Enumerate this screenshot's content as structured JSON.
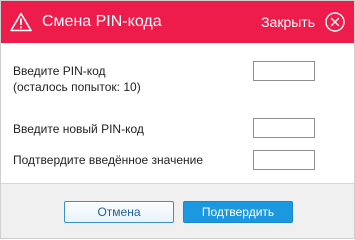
{
  "dialog": {
    "title": "Смена PIN-кода",
    "close_label": "Закрыть",
    "icons": {
      "title_icon": "warning-icon",
      "close_icon": "close-circle-icon"
    },
    "colors": {
      "titlebar": "#ee1c4a",
      "confirm_button": "#1b98e0",
      "cancel_border": "#3b8fd3"
    }
  },
  "form": {
    "current_pin": {
      "label": "Введите PIN-код",
      "note": "(осталось попыток: 10)",
      "value": ""
    },
    "new_pin": {
      "label": "Введите новый PIN-код",
      "value": ""
    },
    "confirm_pin": {
      "label": "Подтвердите введённое значение",
      "value": ""
    }
  },
  "buttons": {
    "cancel": "Отмена",
    "confirm": "Подтвердить"
  }
}
